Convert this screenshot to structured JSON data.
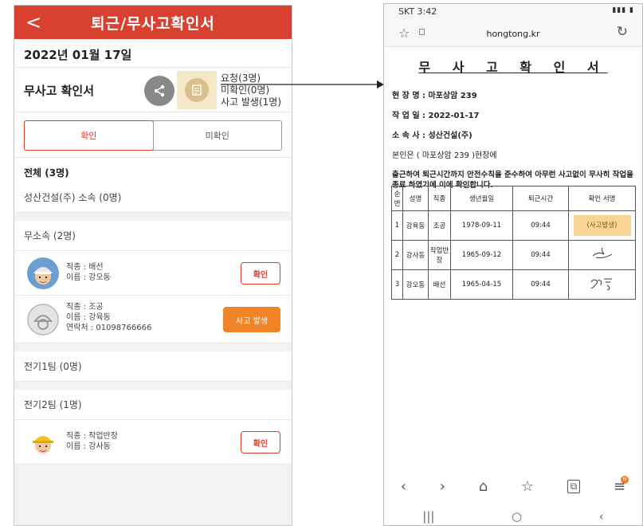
{
  "left_phone": {
    "header": {
      "back_icon": "chevron-left-icon",
      "back_glyph": "<",
      "title": "퇴근/무사고확인서"
    },
    "date": "2022년 01월 17일",
    "doc_label": "무사고 확인서",
    "stats": {
      "requested": "요청(3명)",
      "unconfirmed": "미확인(0명)",
      "accident": "사고 발생(1명)"
    },
    "tabs": {
      "confirmed": "확인",
      "unconfirmed": "미확인"
    },
    "total": "전체 (3명)",
    "groups": [
      {
        "name": "성산건설(주) 소속 (0명)"
      },
      {
        "name": "무소속 (2명)"
      },
      {
        "name": "전기1팀 (0명)"
      },
      {
        "name": "전기2팀 (1명)"
      }
    ],
    "workers": [
      {
        "job": "직종 : 배선",
        "name": "이름 : 강오동",
        "button": "확인"
      },
      {
        "job": "직종 : 조공",
        "name": "이름 : 강육동",
        "contact": "연락처 : 01098766666",
        "button": "사고 발생"
      },
      {
        "job": "직종 : 작업반장",
        "name": "이름 : 강사동",
        "button": "확인"
      }
    ],
    "colors": {
      "accent": "#d8412f",
      "accident": "#f08426"
    }
  },
  "right_phone": {
    "status_time": "SKT 3:42",
    "url": "hongtong.kr",
    "doc_title": "무 사 고 확 인 서",
    "site": "현 장 명 : 마포상암 239",
    "work_date": "작 업 일 : 2022-01-17",
    "company": "소 속 사 : 성산건설(주)",
    "intro": "본인은 ( 마포상암 239 )현장에",
    "statement": "출근하여 퇴근시간까지 안전수칙을 준수하여 아무런 사고없이 무사히 작업을 종료 하였기에 이에 확인합니다.",
    "table": {
      "headers": [
        "순번",
        "성명",
        "직종",
        "생년월일",
        "퇴근시간",
        "확인 서명"
      ],
      "rows": [
        {
          "no": "1",
          "name": "강육동",
          "job": "조공",
          "birth": "1978-09-11",
          "time": "09:44",
          "sign": "(사고발생)"
        },
        {
          "no": "2",
          "name": "강사동",
          "job": "작업반장",
          "birth": "1965-09-12",
          "time": "09:44",
          "sign": ""
        },
        {
          "no": "3",
          "name": "강오동",
          "job": "배선",
          "birth": "1965-04-15",
          "time": "09:44",
          "sign": ""
        }
      ]
    },
    "nav_badge": "N",
    "colors": {
      "accident_badge": "#f9d595"
    }
  }
}
